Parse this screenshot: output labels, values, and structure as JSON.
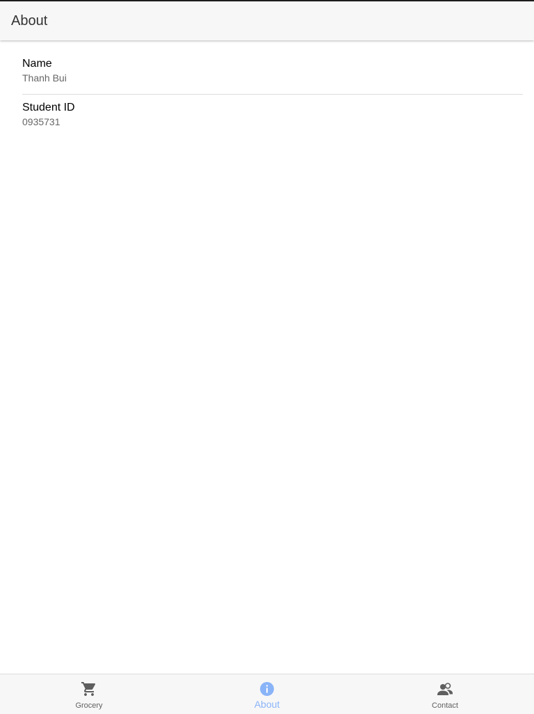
{
  "header": {
    "title": "About"
  },
  "details": [
    {
      "label": "Name",
      "value": "Thanh Bui"
    },
    {
      "label": "Student ID",
      "value": "0935731"
    }
  ],
  "tabbar": {
    "tabs": [
      {
        "label": "Grocery",
        "icon": "cart-icon",
        "active": false
      },
      {
        "label": "About",
        "icon": "info-icon",
        "active": true
      },
      {
        "label": "Contact",
        "icon": "contacts-icon",
        "active": false
      }
    ],
    "active_color": "#8ab4f8",
    "inactive_color": "#5f5f5f"
  }
}
